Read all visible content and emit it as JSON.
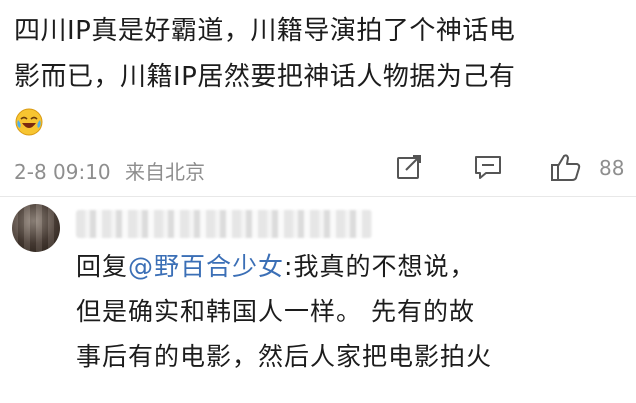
{
  "post": {
    "lines": [
      "四川IP真是好霸道，川籍导演拍了个神话电",
      "影而已，川籍IP居然要把神话人物据为己有"
    ],
    "emoji": "laugh-cry-emoji"
  },
  "meta": {
    "timestamp": "2-8 09:10",
    "source": "来自北京",
    "like_count": "88"
  },
  "icons": {
    "share": "share-icon",
    "comment": "comment-icon",
    "like": "thumbs-up-icon"
  },
  "reply": {
    "prefix": "回复",
    "mention": "@野百合少女",
    "first_line_rest": ":我真的不想说，",
    "lines": [
      "但是确实和韩国人一样。 先有的故",
      "事后有的电影，然后人家把电影拍火"
    ]
  },
  "colors": {
    "text": "#1c1c1c",
    "meta": "#8e8e8e",
    "mention": "#3b6fb6"
  }
}
